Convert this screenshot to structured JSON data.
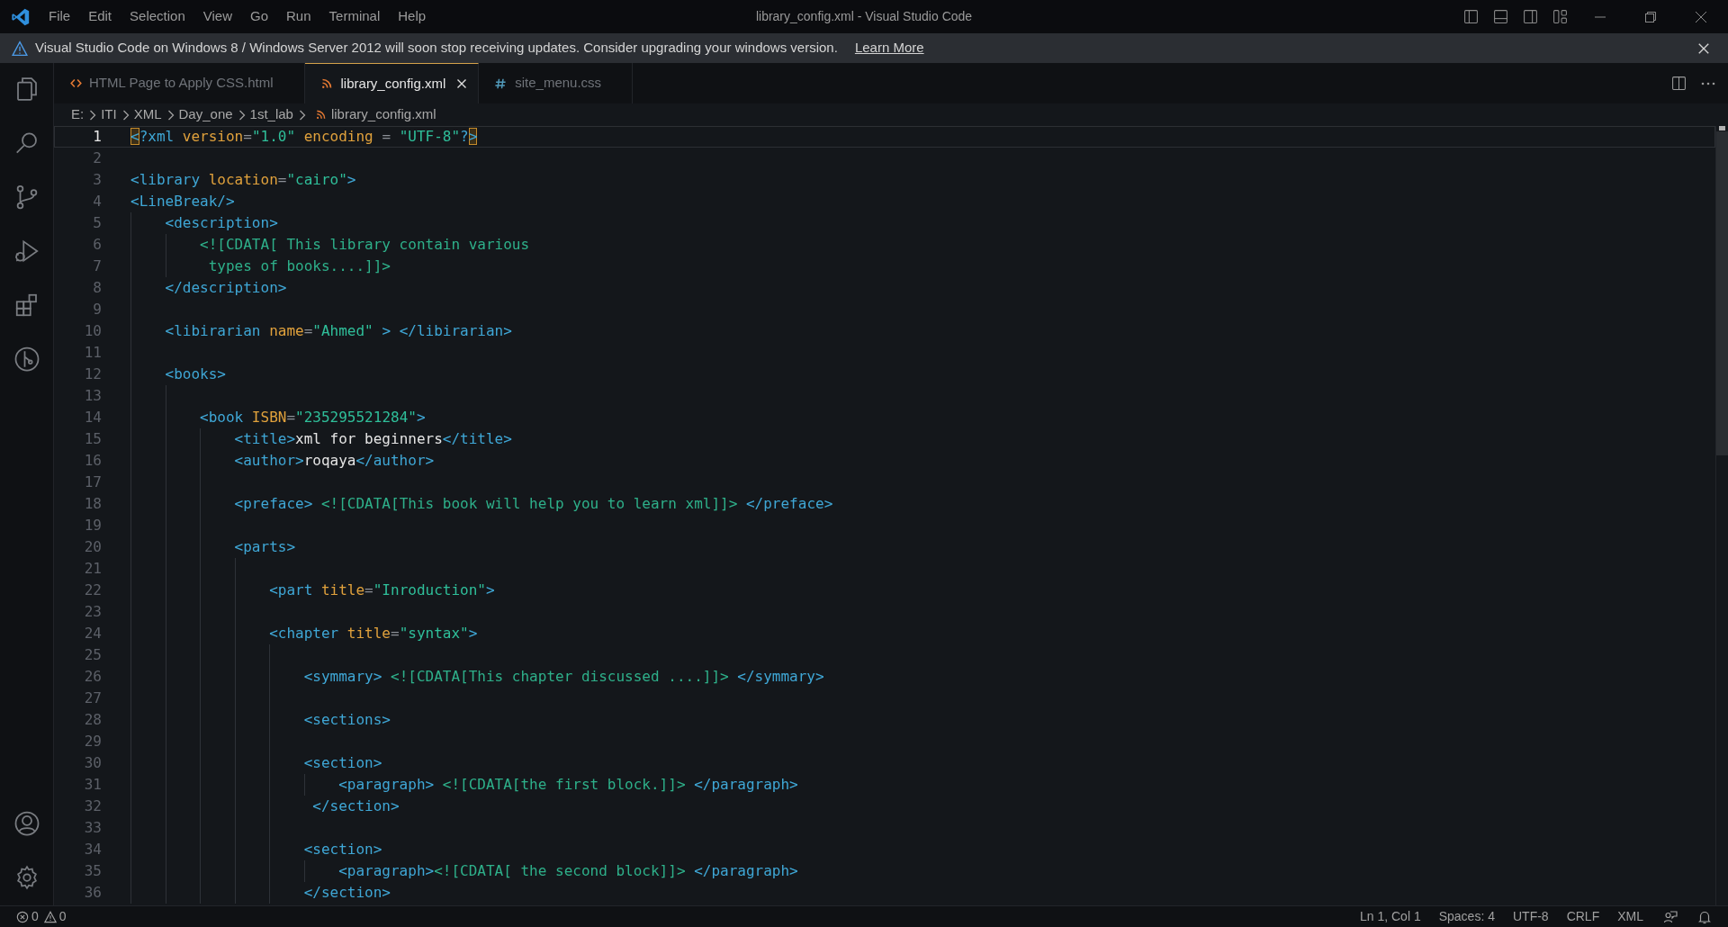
{
  "title_bar": {
    "menu": [
      "File",
      "Edit",
      "Selection",
      "View",
      "Go",
      "Run",
      "Terminal",
      "Help"
    ],
    "title": "library_config.xml - Visual Studio Code"
  },
  "notification": {
    "message": "Visual Studio Code on Windows 8 / Windows Server 2012 will soon stop receiving updates. Consider upgrading your windows version.",
    "link": "Learn More"
  },
  "tabs": [
    {
      "label": "HTML Page to Apply CSS.html",
      "kind": "html",
      "selected": false
    },
    {
      "label": "library_config.xml",
      "kind": "xml",
      "selected": true
    },
    {
      "label": "site_menu.css",
      "kind": "css",
      "selected": false
    }
  ],
  "breadcrumbs": [
    "E:",
    "ITI",
    "XML",
    "Day_one",
    "1st_lab",
    "library_config.xml"
  ],
  "editor": {
    "lines": [
      {
        "number": "1",
        "current": true,
        "tokens": [
          {
            "kind": "match",
            "text": "<"
          },
          {
            "kind": "tag",
            "text": "?xml"
          },
          {
            "kind": "attr",
            "text": " version"
          },
          {
            "kind": "punct",
            "text": "="
          },
          {
            "kind": "string",
            "text": "\"1.0\""
          },
          {
            "kind": "attr",
            "text": " encoding"
          },
          {
            "kind": "punct",
            "text": " = "
          },
          {
            "kind": "string",
            "text": "\"UTF-8\""
          },
          {
            "kind": "tag",
            "text": "?"
          },
          {
            "kind": "match",
            "text": ">"
          }
        ]
      },
      {
        "number": "2",
        "current": false
      },
      {
        "number": "3",
        "current": false,
        "tokens": [
          {
            "kind": "tag",
            "text": "<library"
          },
          {
            "kind": "attr",
            "text": " location"
          },
          {
            "kind": "punct",
            "text": "="
          },
          {
            "kind": "string",
            "text": "\"cairo\""
          },
          {
            "kind": "tag",
            "text": ">"
          }
        ]
      },
      {
        "number": "4",
        "current": false,
        "tokens": [
          {
            "kind": "tag",
            "text": "<LineBreak/>"
          }
        ]
      },
      {
        "number": "5",
        "current": false,
        "tokens": [
          {
            "kind": "tag",
            "text": "    <description>"
          }
        ]
      },
      {
        "number": "6",
        "current": false,
        "tokens": [
          {
            "kind": "cdata",
            "text": "        <![CDATA[ This library contain various"
          }
        ]
      },
      {
        "number": "7",
        "current": false,
        "tokens": [
          {
            "kind": "cdata",
            "text": "         types of books....]]>"
          }
        ]
      },
      {
        "number": "8",
        "current": false,
        "tokens": [
          {
            "kind": "tag",
            "text": "    </description>"
          }
        ]
      },
      {
        "number": "9",
        "current": false
      },
      {
        "number": "10",
        "current": false,
        "tokens": [
          {
            "kind": "tag",
            "text": "    <libirarian"
          },
          {
            "kind": "attr",
            "text": " name"
          },
          {
            "kind": "punct",
            "text": "="
          },
          {
            "kind": "string",
            "text": "\"Ahmed\""
          },
          {
            "kind": "tag",
            "text": " > </libirarian>"
          }
        ]
      },
      {
        "number": "11",
        "current": false
      },
      {
        "number": "12",
        "current": false,
        "tokens": [
          {
            "kind": "tag",
            "text": "    <books>"
          }
        ]
      },
      {
        "number": "13",
        "current": false
      },
      {
        "number": "14",
        "current": false,
        "tokens": [
          {
            "kind": "tag",
            "text": "        <book"
          },
          {
            "kind": "attr",
            "text": " ISBN"
          },
          {
            "kind": "punct",
            "text": "="
          },
          {
            "kind": "string",
            "text": "\"235295521284\""
          },
          {
            "kind": "tag",
            "text": ">"
          }
        ]
      },
      {
        "number": "15",
        "current": false,
        "tokens": [
          {
            "kind": "tag",
            "text": "            <title>"
          },
          {
            "kind": "text",
            "text": "xml for beginners"
          },
          {
            "kind": "tag",
            "text": "</title>"
          }
        ]
      },
      {
        "number": "16",
        "current": false,
        "tokens": [
          {
            "kind": "tag",
            "text": "            <author>"
          },
          {
            "kind": "text",
            "text": "roqaya"
          },
          {
            "kind": "tag",
            "text": "</author>"
          }
        ]
      },
      {
        "number": "17",
        "current": false
      },
      {
        "number": "18",
        "current": false,
        "tokens": [
          {
            "kind": "tag",
            "text": "            <preface>"
          },
          {
            "kind": "cdata",
            "text": " <![CDATA[This book will help you to learn xml]]>"
          },
          {
            "kind": "tag",
            "text": " </preface>"
          }
        ]
      },
      {
        "number": "19",
        "current": false
      },
      {
        "number": "20",
        "current": false,
        "tokens": [
          {
            "kind": "tag",
            "text": "            <parts>"
          }
        ]
      },
      {
        "number": "21",
        "current": false
      },
      {
        "number": "22",
        "current": false,
        "tokens": [
          {
            "kind": "tag",
            "text": "                <part"
          },
          {
            "kind": "attr",
            "text": " title"
          },
          {
            "kind": "punct",
            "text": "="
          },
          {
            "kind": "string",
            "text": "\"Inroduction\""
          },
          {
            "kind": "tag",
            "text": ">"
          }
        ]
      },
      {
        "number": "23",
        "current": false
      },
      {
        "number": "24",
        "current": false,
        "tokens": [
          {
            "kind": "tag",
            "text": "                <chapter"
          },
          {
            "kind": "attr",
            "text": " title"
          },
          {
            "kind": "punct",
            "text": "="
          },
          {
            "kind": "string",
            "text": "\"syntax\""
          },
          {
            "kind": "tag",
            "text": ">"
          }
        ]
      },
      {
        "number": "25",
        "current": false
      },
      {
        "number": "26",
        "current": false,
        "tokens": [
          {
            "kind": "tag",
            "text": "                    <symmary>"
          },
          {
            "kind": "cdata",
            "text": " <![CDATA[This chapter discussed ....]]>"
          },
          {
            "kind": "tag",
            "text": " </symmary>"
          }
        ]
      },
      {
        "number": "27",
        "current": false
      },
      {
        "number": "28",
        "current": false,
        "tokens": [
          {
            "kind": "tag",
            "text": "                    <sections>"
          }
        ]
      },
      {
        "number": "29",
        "current": false
      },
      {
        "number": "30",
        "current": false,
        "tokens": [
          {
            "kind": "tag",
            "text": "                    <section>"
          }
        ]
      },
      {
        "number": "31",
        "current": false,
        "tokens": [
          {
            "kind": "tag",
            "text": "                        <paragraph>"
          },
          {
            "kind": "cdata",
            "text": " <![CDATA[the first block.]]>"
          },
          {
            "kind": "tag",
            "text": " </paragraph>"
          }
        ]
      },
      {
        "number": "32",
        "current": false,
        "tokens": [
          {
            "kind": "tag",
            "text": "                     </section>"
          }
        ]
      },
      {
        "number": "33",
        "current": false
      },
      {
        "number": "34",
        "current": false,
        "tokens": [
          {
            "kind": "tag",
            "text": "                    <section>"
          }
        ]
      },
      {
        "number": "35",
        "current": false,
        "tokens": [
          {
            "kind": "tag",
            "text": "                        <paragraph>"
          },
          {
            "kind": "cdata",
            "text": "<![CDATA[ the second block]]>"
          },
          {
            "kind": "tag",
            "text": " </paragraph>"
          }
        ]
      },
      {
        "number": "36",
        "current": false,
        "tokens": [
          {
            "kind": "tag",
            "text": "                    </section>"
          }
        ]
      }
    ]
  },
  "status_bar": {
    "errors": "0",
    "warnings": "0",
    "items": [
      "Ln 1, Col 1",
      "Spaces: 4",
      "UTF-8",
      "CRLF",
      "XML"
    ]
  }
}
